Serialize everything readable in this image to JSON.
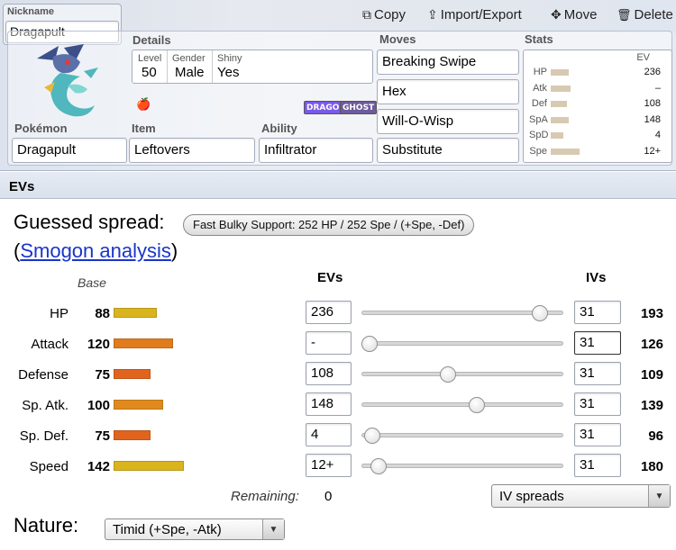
{
  "toolbar": {
    "copy": "Copy",
    "import_export": "Import/Export",
    "move": "Move",
    "delete": "Delete"
  },
  "set": {
    "nickname_label": "Nickname",
    "nickname": "Dragapult",
    "details_label": "Details",
    "level_label": "Level",
    "level": "50",
    "gender_label": "Gender",
    "gender": "Male",
    "shiny_label": "Shiny",
    "shiny": "Yes",
    "types": [
      {
        "name": "DRAGON",
        "color": "#7a5ae8"
      },
      {
        "name": "GHOST",
        "color": "#6e5a9c"
      }
    ],
    "pokemon_label": "Pokémon",
    "pokemon": "Dragapult",
    "item_label": "Item",
    "item": "Leftovers",
    "ability_label": "Ability",
    "ability": "Infiltrator",
    "moves_label": "Moves",
    "moves": [
      "Breaking Swipe",
      "Hex",
      "Will-O-Wisp",
      "Substitute"
    ],
    "stats_label": "Stats",
    "stats_ev_header": "EV",
    "stats": [
      {
        "name": "HP",
        "ev": "236"
      },
      {
        "name": "Atk",
        "ev": "–"
      },
      {
        "name": "Def",
        "ev": "108"
      },
      {
        "name": "SpA",
        "ev": "148"
      },
      {
        "name": "SpD",
        "ev": "4"
      },
      {
        "name": "Spe",
        "ev": "12+"
      }
    ]
  },
  "evs": {
    "section_title": "EVs",
    "guessed_label": "Guessed spread:",
    "guessed_spread": "Fast Bulky Support: 252 HP / 252 Spe / (+Spe, -Def)",
    "smogon_prefix": "(",
    "smogon_link": "Smogon analysis",
    "smogon_suffix": ")",
    "base_header": "Base",
    "evs_header": "EVs",
    "ivs_header": "IVs",
    "rows": [
      {
        "name": "HP",
        "base": "88",
        "base_value": 88,
        "bar_color": "#d9b41e",
        "ev": "236",
        "ev_value": 236,
        "iv": "31",
        "total": "193"
      },
      {
        "name": "Attack",
        "base": "120",
        "base_value": 120,
        "bar_color": "#e07c1e",
        "ev": "-",
        "ev_value": 0,
        "iv": "31",
        "total": "126"
      },
      {
        "name": "Defense",
        "base": "75",
        "base_value": 75,
        "bar_color": "#e0641e",
        "ev": "108",
        "ev_value": 108,
        "iv": "31",
        "total": "109"
      },
      {
        "name": "Sp. Atk.",
        "base": "100",
        "base_value": 100,
        "bar_color": "#e08a1e",
        "ev": "148",
        "ev_value": 148,
        "iv": "31",
        "total": "139"
      },
      {
        "name": "Sp. Def.",
        "base": "75",
        "base_value": 75,
        "bar_color": "#e0641e",
        "ev": "4",
        "ev_value": 4,
        "iv": "31",
        "total": "96"
      },
      {
        "name": "Speed",
        "base": "142",
        "base_value": 142,
        "bar_color": "#d9b41e",
        "ev": "12+",
        "ev_value": 12,
        "iv": "31",
        "total": "180"
      }
    ],
    "remaining_label": "Remaining:",
    "remaining": "0",
    "iv_spreads": "IV spreads",
    "nature_label": "Nature:",
    "nature": "Timid (+Spe, -Atk)"
  }
}
